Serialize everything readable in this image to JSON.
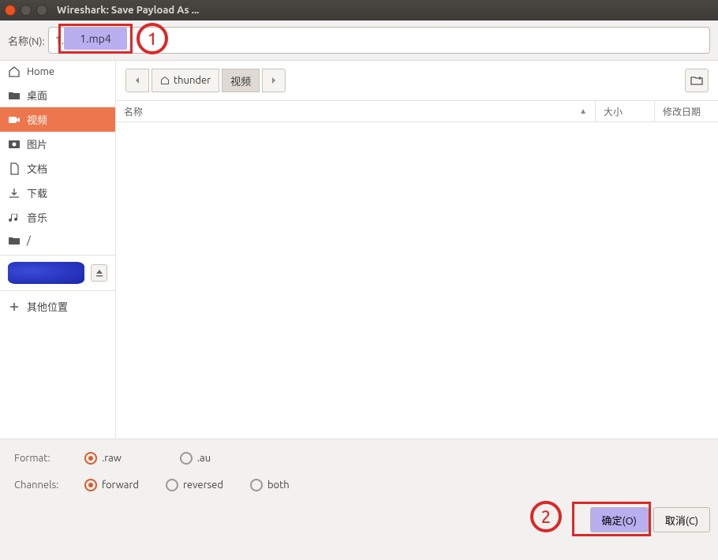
{
  "window": {
    "title": "Wireshark: Save Payload As ..."
  },
  "name_field": {
    "label": "名称(N):",
    "value": "1.mp4"
  },
  "annotations": {
    "badge1": "1",
    "badge2": "2"
  },
  "sidebar": {
    "items": [
      {
        "label": "Home",
        "icon": "home"
      },
      {
        "label": "桌面",
        "icon": "folder"
      },
      {
        "label": "视频",
        "icon": "video",
        "active": true
      },
      {
        "label": "图片",
        "icon": "photo"
      },
      {
        "label": "文档",
        "icon": "doc"
      },
      {
        "label": "下载",
        "icon": "download"
      },
      {
        "label": "音乐",
        "icon": "music"
      },
      {
        "label": "/",
        "icon": "folder"
      }
    ],
    "other": "其他位置"
  },
  "path": {
    "seg1": "thunder",
    "seg2": "视频"
  },
  "list": {
    "col_name": "名称",
    "col_size": "大小",
    "col_date": "修改日期"
  },
  "options": {
    "format_label": "Format:",
    "format_choices": [
      ".raw",
      ".au"
    ],
    "format_selected": ".raw",
    "channels_label": "Channels:",
    "channels_choices": [
      "forward",
      "reversed",
      "both"
    ],
    "channels_selected": "forward"
  },
  "buttons": {
    "ok": "确定(O)",
    "cancel": "取消(C)"
  }
}
